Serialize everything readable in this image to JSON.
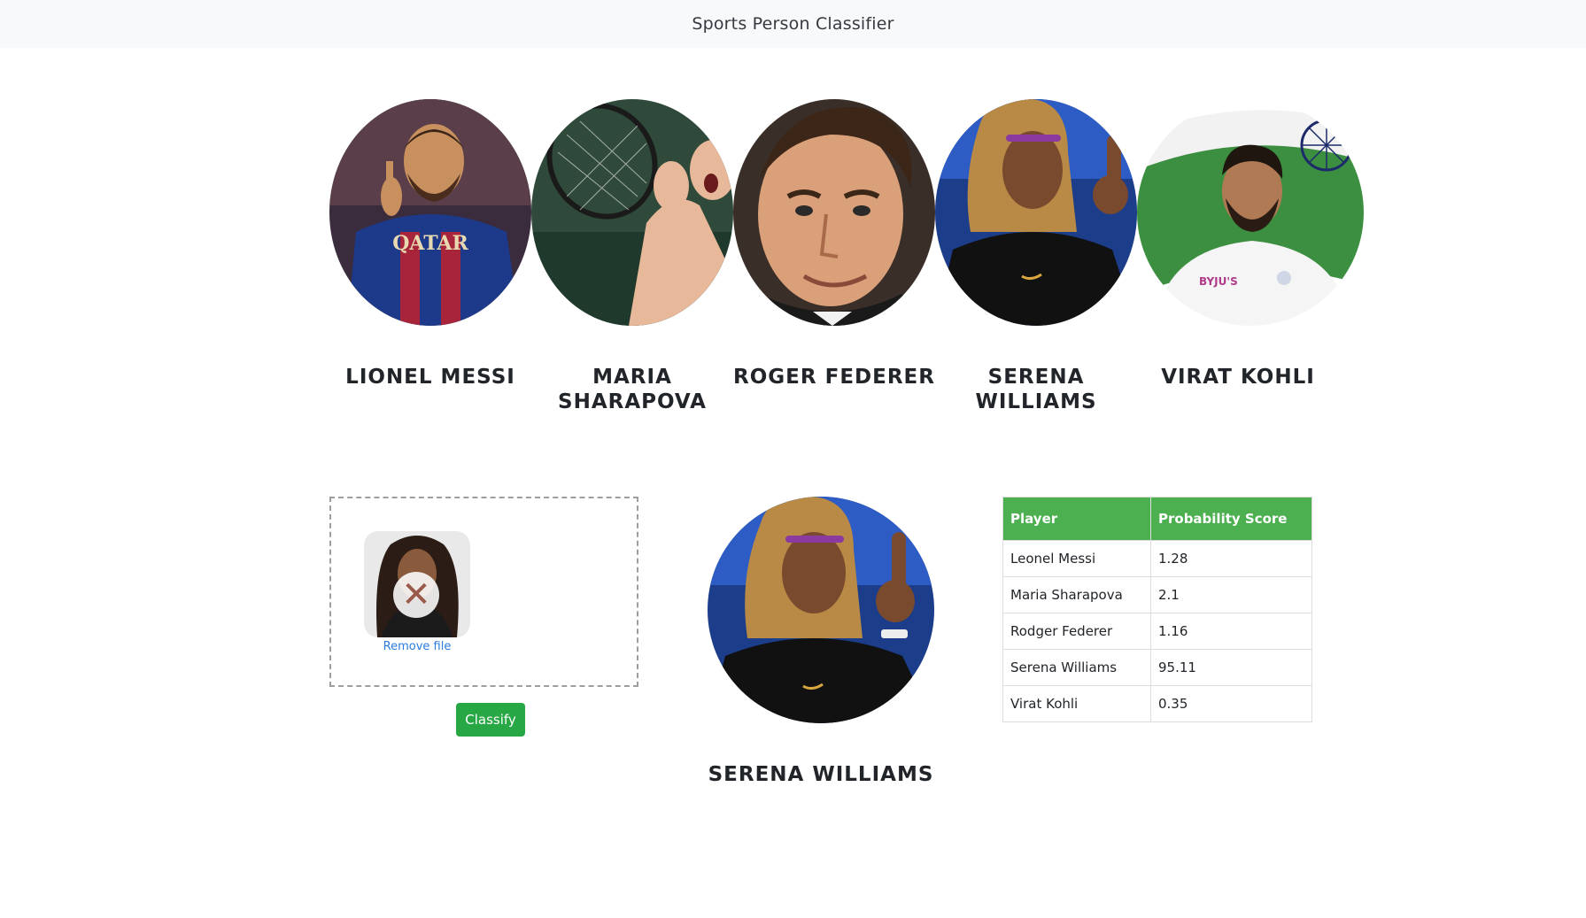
{
  "navbar": {
    "brand": "Sports Person Classifier"
  },
  "players": [
    {
      "name": "LIONEL MESSI",
      "photo_icon": "lionel-messi-photo"
    },
    {
      "name": "MARIA SHARAPOVA",
      "photo_icon": "maria-sharapova-photo"
    },
    {
      "name": "ROGER FEDERER",
      "photo_icon": "roger-federer-photo"
    },
    {
      "name": "SERENA WILLIAMS",
      "photo_icon": "serena-williams-photo"
    },
    {
      "name": "VIRAT KOHLI",
      "photo_icon": "virat-kohli-photo"
    }
  ],
  "upload": {
    "remove_label": "Remove file",
    "remove_icon": "close-icon",
    "classify_label": "Classify"
  },
  "result": {
    "name": "SERENA WILLIAMS",
    "photo_icon": "serena-williams-photo"
  },
  "scores_table": {
    "headers": [
      "Player",
      "Probability Score"
    ],
    "rows": [
      {
        "player": "Leonel Messi",
        "score": "1.28"
      },
      {
        "player": "Maria Sharapova",
        "score": "2.1"
      },
      {
        "player": "Rodger Federer",
        "score": "1.16"
      },
      {
        "player": "Serena Williams",
        "score": "95.11"
      },
      {
        "player": "Virat Kohli",
        "score": "0.35"
      }
    ]
  },
  "colors": {
    "header_green": "#4caf50",
    "button_green": "#28a745",
    "link_blue": "#2a7bdd",
    "navbar_bg": "#f8f9fa"
  }
}
